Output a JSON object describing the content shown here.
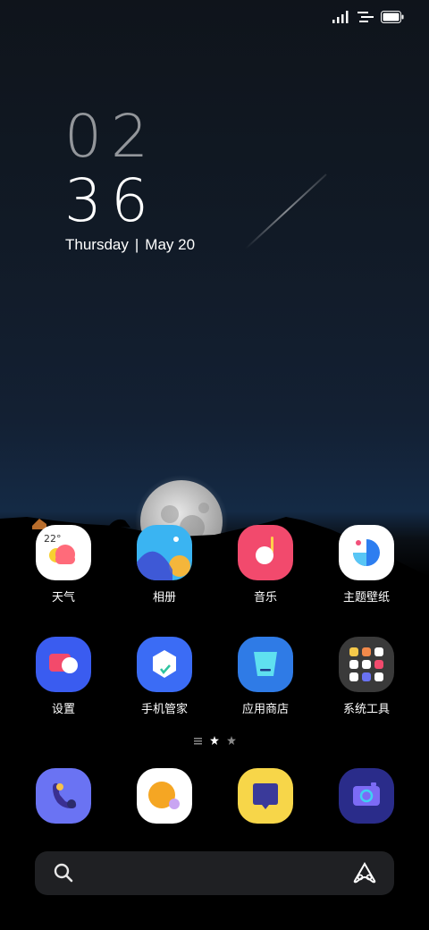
{
  "status_bar": {
    "icons": [
      "signal-icon",
      "network-icon",
      "battery-icon"
    ]
  },
  "clock": {
    "hour": "02",
    "minute": "36"
  },
  "date": {
    "weekday": "Thursday",
    "separator": "|",
    "day": "May 20"
  },
  "home_apps": [
    {
      "label": "天气",
      "icon": "weather-icon",
      "temp": "22°"
    },
    {
      "label": "相册",
      "icon": "gallery-icon"
    },
    {
      "label": "音乐",
      "icon": "music-icon"
    },
    {
      "label": "主题壁纸",
      "icon": "themes-icon"
    },
    {
      "label": "设置",
      "icon": "settings-icon"
    },
    {
      "label": "手机管家",
      "icon": "security-icon"
    },
    {
      "label": "应用商店",
      "icon": "app-store-icon"
    },
    {
      "label": "系统工具",
      "icon": "tools-folder-icon"
    }
  ],
  "page_indicator": {
    "pages": 3,
    "current": 1
  },
  "dock": [
    {
      "icon": "phone-icon"
    },
    {
      "icon": "browser-icon"
    },
    {
      "icon": "messages-icon"
    },
    {
      "icon": "camera-icon"
    }
  ],
  "search_bar": {
    "left_icon": "search-icon",
    "right_icon": "assistant-icon"
  },
  "colors": {
    "settings_bg": "#3a5cf0",
    "security_bg": "#3b6cf5",
    "store_bg": "#2f7be6",
    "music_bg": "#f24a6d",
    "phone_bg": "#6a73f3",
    "messages_bg": "#f7d649",
    "camera_bg": "#2a2c8a"
  }
}
